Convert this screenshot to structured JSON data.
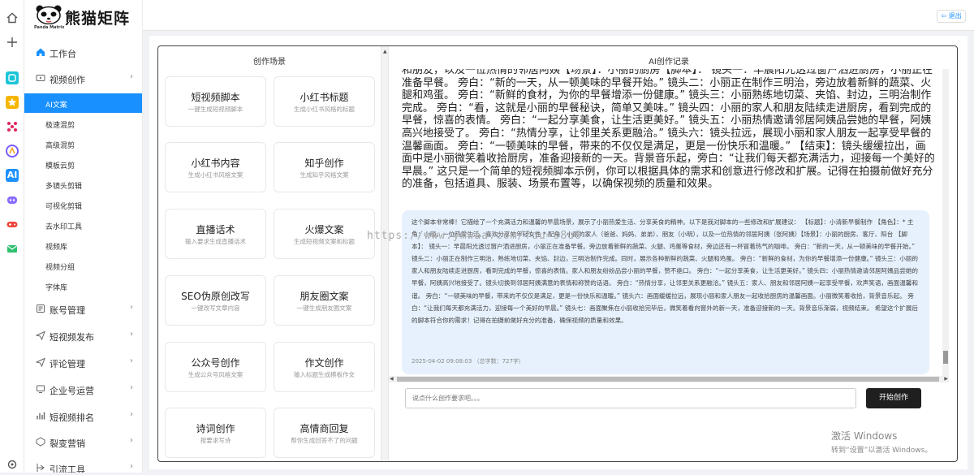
{
  "brand": {
    "name": "熊猫矩阵",
    "subtitle": "Panda Matrix"
  },
  "topbar": {
    "logout_label": "退出"
  },
  "iconbar": [
    {
      "icon": "home-icon",
      "color": "#555555"
    },
    {
      "icon": "plus-icon",
      "color": "#555555"
    },
    {
      "icon": "app-teal-icon",
      "color": "#1cc5d8"
    },
    {
      "icon": "star-app-icon",
      "color": "#f7b500"
    },
    {
      "icon": "network-app-icon",
      "color": "#e0245e"
    },
    {
      "icon": "ai-circle-app-icon",
      "color": "#7b5cff"
    },
    {
      "icon": "ai-app-icon",
      "color": "#1e90ff"
    },
    {
      "icon": "discord-app-icon",
      "color": "#8a6cff"
    },
    {
      "icon": "gamepad-app-icon",
      "color": "#f0453a"
    },
    {
      "icon": "mail-app-icon",
      "color": "#2fbf71"
    },
    {
      "icon": "settings-icon",
      "color": "#555555"
    }
  ],
  "sidebar": {
    "workbench": "工作台",
    "video_creation": "视频创作",
    "sub_items": [
      "AI文案",
      "极速混剪",
      "高级混剪",
      "模板云剪",
      "多镜头剪辑",
      "可视化剪辑",
      "去水印工具",
      "视频库",
      "视频分组",
      "字体库"
    ],
    "active_sub": 0,
    "groups": [
      "账号管理",
      "短视频发布",
      "评论管理",
      "企业号运营",
      "短视频排名",
      "裂变营销",
      "引流工具"
    ]
  },
  "scene_panel": {
    "title": "创作场景",
    "cards": [
      {
        "title": "短视频脚本",
        "desc": "一键生成短视频脚本"
      },
      {
        "title": "小红书标题",
        "desc": "生成小红书风格的标题"
      },
      {
        "title": "小红书内容",
        "desc": "生成小红书风格文案"
      },
      {
        "title": "知乎创作",
        "desc": "生成知乎风格文案"
      },
      {
        "title": "直播话术",
        "desc": "输入要求生成直播话术"
      },
      {
        "title": "火爆文案",
        "desc": "生成短视频文案和标题"
      },
      {
        "title": "SEO伪原创改写",
        "desc": "一键改写文章内容"
      },
      {
        "title": "朋友圈文案",
        "desc": "一键生成朋友圈文案"
      },
      {
        "title": "公众号创作",
        "desc": "生成公众号风格文案"
      },
      {
        "title": "作文创作",
        "desc": "输入标题生成模板作文"
      },
      {
        "title": "诗词创作",
        "desc": "按要求写诗"
      },
      {
        "title": "高情商回复",
        "desc": "帮你生成回答不了的问题"
      }
    ]
  },
  "record_panel": {
    "title": "AI创作记录",
    "main_text": "和朋友，以及一位热情的邻居阿姨【场景】：小丽的厨房【脚本】： 镜头一：早晨阳光透过窗户洒进厨房，小丽正在准备早餐。 旁白：“新的一天，从一顿美味的早餐开始。” 镜头二：小丽正在制作三明治，旁边放着新鲜的蔬菜、火腿和鸡蛋。 旁白：“新鲜的食材，为你的早餐增添一份健康。” 镜头三：小丽熟练地切菜、夹馅、封边，三明治制作完成。 旁白：“看，这就是小丽的早餐秘诀，简单又美味。” 镜头四：小丽的家人和朋友陆续走进厨房，看到完成的早餐，惊喜的表情。 旁白：“一起分享美食，让生活更美好。” 镜头五：小丽热情邀请邻居阿姨品尝她的早餐，阿姨高兴地接受了。 旁白：“热情分享，让邻里关系更融洽。” 镜头六：镜头拉远，展现小丽和家人朋友一起享受早餐的温馨画面。 旁白：“一顿美味的早餐，带来的不仅仅是满足，更是一份快乐和温暖。” 【结束】：镜头缓缓拉出，画面中是小丽微笑着收拾厨房，准备迎接新的一天。背景音乐起，旁白：“让我们每天都充满活力，迎接每一个美好的早晨。” 这只是一个简单的短视频脚本示例，你可以根据具体的需求和创意进行修改和扩展。记得在拍摄前做好充分的准备，包括道具、服装、场景布置等，以确保视频的质量和效果。",
    "reply_text": "这个脚本非常棒！它描绘了一个充满活力和温馨的早晨场景，展示了小丽热爱生活、分享美食的精神。以下是我对脚本的一些修改和扩展建议： 【标题】：小清新早餐制作 【角色】：* 主角：小丽，一位热爱生活、喜欢分享的年轻女性 * 配角：小丽的家人（爸爸、妈妈、弟弟）、朋友（小明），以及一位热情的邻居阿姨（张阿姨）【场景】：小丽的厨房、客厅、阳台 【脚本】： 镜头一：早晨阳光透过窗户洒进厨房，小丽正在准备早餐。旁边放着新鲜的蔬菜、火腿、鸡蛋等食材，旁边还有一杯冒着热气的咖啡。 旁白：“新的一天，从一顿美味的早餐开始。” 镜头二：小丽正在制作三明治，熟练地切菜、夹馅、封边，三明治制作完成。同时，展示各种新鲜的蔬菜、火腿和鸡蛋。 旁白：“新鲜的食材，为你的早餐增添一份健康。” 镜头三：小丽的家人和朋友陆续走进厨房，看到完成的早餐，惊喜的表情。家人和朋友纷纷品尝小丽的早餐，赞不绝口。 旁白：“一起分享美食，让生活更美好。” 镜头四：小丽热情邀请邻居阿姨品尝她的早餐，阿姨高兴地接受了。镜头切换到邻居阿姨满意的表情和称赞的话语。 旁白：“热情分享，让邻里关系更融洽。” 镜头五：家人、朋友和邻居阿姨一起享受早餐，欢声笑语，画面温馨和谐。 旁白：“一顿美味的早餐，带来的不仅仅是满足，更是一份快乐和温暖。” 镜头六：画面缓缓拉远，展现小丽和家人朋友一起收拾厨房的温馨画面。小丽微笑着收拾，背景音乐起。 旁白：“让我们每天都充满活力，迎接每一个美好的早晨。” 镜头七：画面聚焦在小丽收拾完毕后，微笑着看向窗外的新一天，准备迎接新的一天。背景音乐渐弱，视频结束。 希望这个扩展后的脚本符合你的需求！记得在拍摄前做好充分的准备，确保视频的质量和效果。",
    "timestamp": "2025-04-02 09:08:03 （总字数：727字）"
  },
  "input": {
    "placeholder": "说点什么创作要求吧。。。"
  },
  "start_button": "开始创作",
  "watermark_url": "https://www.ymwaa.com/?uu=s8u0",
  "os_notice": {
    "line1": "激活 Windows",
    "line2": "转到“设置”以激活 Windows。"
  }
}
